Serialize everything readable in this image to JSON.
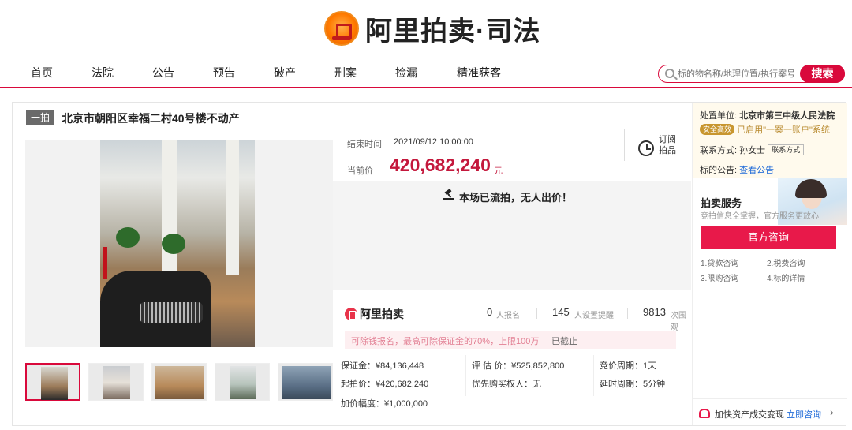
{
  "brand": {
    "title": "阿里拍卖·司法"
  },
  "nav": {
    "items": [
      "首页",
      "法院",
      "公告",
      "预告",
      "破产",
      "刑案",
      "捡漏",
      "精准获客"
    ]
  },
  "search": {
    "placeholder": "标的物名称/地理位置/执行案号",
    "button": "搜索"
  },
  "item": {
    "round_badge": "一拍",
    "title": "北京市朝阳区幸福二村40号楼不动产"
  },
  "auction": {
    "end_time_label": "结束时间",
    "end_time": "2021/09/12 10:00:00",
    "current_price_label": "当前价",
    "current_price": "420,682,240",
    "currency_unit": "元",
    "subscribe_label": "订阅拍品",
    "failed_notice": "本场已流拍，无人出价！"
  },
  "stats": {
    "logo_text": "阿里拍卖",
    "registered_count": "0",
    "registered_label": "人报名",
    "reminder_count": "145",
    "reminder_label": "人设置提醒",
    "views_count": "9813",
    "views_label": "次围观"
  },
  "deposit_notice": {
    "text": "可除钱报名，最高可除保证金的70%，上限100万",
    "status": "已截止"
  },
  "details": {
    "deposit": "保证金：¥84,136,448",
    "assessed_price": "评 估 价：¥525,852,800",
    "bid_period": "竞价周期：1天",
    "start_price": "起拍价：¥420,682,240",
    "priority_buyer": "优先购买权人",
    "priority_value": "：无",
    "delay_period": "延时周期：5分钟",
    "increment": "加价幅度：¥1,000,000"
  },
  "sidebar": {
    "court_label": "处置单位:",
    "court_name": "北京市第三中级人民法院",
    "safety_badge": "安全高效",
    "account_notice": "已启用\"一案一账户\"系统",
    "contact_label": "联系方式:",
    "contact_name": "孙女士",
    "contact_button": "联系方式",
    "notice_label": "标的公告:",
    "notice_link": "查看公告",
    "service_title": "拍卖服务",
    "service_subtitle": "竞拍信息全掌握，官方服务更放心",
    "consult_button": "官方咨询",
    "service_links": [
      "1.贷款咨询",
      "2.税费咨询",
      "3.限购咨询",
      "4.标的详情"
    ],
    "footer_text": "加快资产成交变现",
    "footer_link": "立即咨询"
  },
  "colors": {
    "accent": "#d9093b",
    "price": "#c4183c"
  },
  "icons": [
    "emblem-icon",
    "search-icon",
    "clock-icon",
    "hammer-icon",
    "arrow-right-icon"
  ]
}
